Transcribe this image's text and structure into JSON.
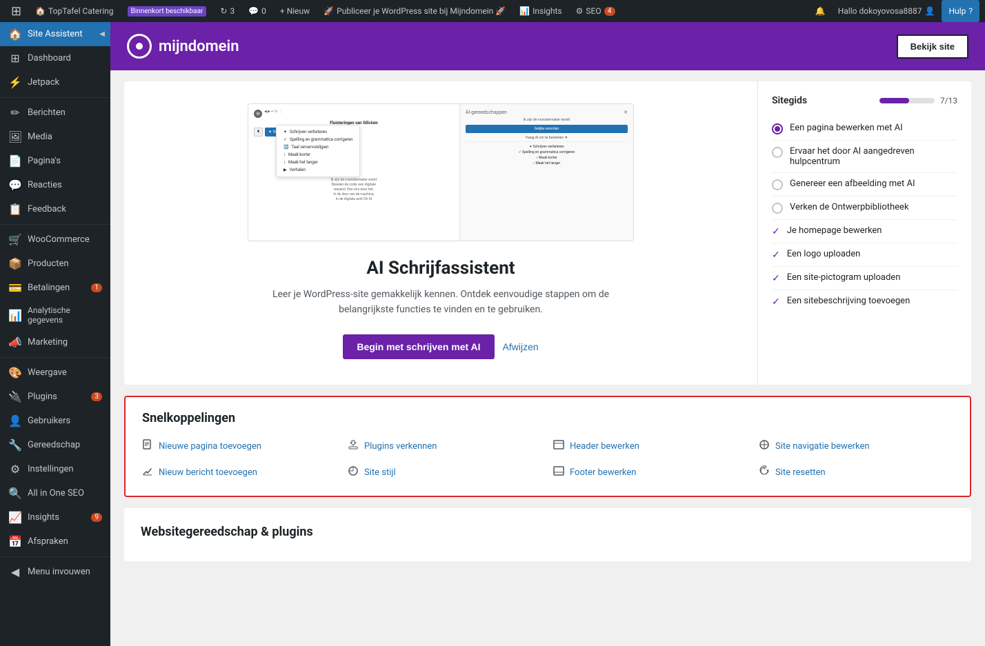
{
  "adminbar": {
    "site_name": "TopTafel Catering",
    "soon_label": "Binnenkort beschikbaar",
    "updates_count": "3",
    "comments_count": "0",
    "new_label": "+ Nieuw",
    "publish_label": "Publiceer je WordPress site bij Mijndomein 🚀",
    "insights_label": "Insights",
    "seo_label": "SEO",
    "seo_badge": "4",
    "hello_label": "Hallo dokoyovosa8887",
    "help_label": "Hulp"
  },
  "sidebar": {
    "items": [
      {
        "label": "Site Assistent",
        "icon": "🏠",
        "active": true
      },
      {
        "label": "Dashboard",
        "icon": "⊞"
      },
      {
        "label": "Jetpack",
        "icon": "⚡"
      },
      {
        "label": "Berichten",
        "icon": "✏️"
      },
      {
        "label": "Media",
        "icon": "🖼"
      },
      {
        "label": "Pagina's",
        "icon": "📄"
      },
      {
        "label": "Reacties",
        "icon": "💬"
      },
      {
        "label": "Feedback",
        "icon": "📋"
      },
      {
        "label": "WooCommerce",
        "icon": "🛒"
      },
      {
        "label": "Producten",
        "icon": "📦"
      },
      {
        "label": "Betalingen",
        "icon": "💳",
        "badge": "1"
      },
      {
        "label": "Analytische gegevens",
        "icon": "📊"
      },
      {
        "label": "Marketing",
        "icon": "📣"
      },
      {
        "label": "Weergave",
        "icon": "🎨"
      },
      {
        "label": "Plugins",
        "icon": "🔌",
        "badge": "3"
      },
      {
        "label": "Gebruikers",
        "icon": "👤"
      },
      {
        "label": "Gereedschap",
        "icon": "🔧"
      },
      {
        "label": "Instellingen",
        "icon": "⚙️"
      },
      {
        "label": "All in One SEO",
        "icon": "🔍"
      },
      {
        "label": "Insights",
        "icon": "📈",
        "badge": "9"
      },
      {
        "label": "Afspraken",
        "icon": "📅"
      },
      {
        "label": "Menu invouwen",
        "icon": "◀"
      }
    ]
  },
  "header": {
    "logo_text": "mijndomein",
    "bekijk_site": "Bekijk site"
  },
  "sitegids": {
    "title": "Sitegids",
    "progress": "7/13",
    "progress_percent": 54,
    "items": [
      {
        "label": "Een pagina bewerken met AI",
        "status": "active"
      },
      {
        "label": "Ervaar het door AI aangedreven hulpcentrum",
        "status": "empty"
      },
      {
        "label": "Genereer een afbeelding met AI",
        "status": "empty"
      },
      {
        "label": "Verken de Ontwerpbibliotheek",
        "status": "empty"
      },
      {
        "label": "Je homepage bewerken",
        "status": "check"
      },
      {
        "label": "Een logo uploaden",
        "status": "check"
      },
      {
        "label": "Een site-pictogram uploaden",
        "status": "check"
      },
      {
        "label": "Een sitebeschrijving toevoegen",
        "status": "check"
      }
    ]
  },
  "ai_feature": {
    "title": "AI Schrijfassistent",
    "description": "Leer je WordPress-site gemakkelijk kennen. Ontdek eenvoudige stappen om de belangrijkste functies te vinden en te gebruiken.",
    "primary_btn": "Begin met schrijven met AI",
    "secondary_btn": "Afwijzen",
    "preview_title": "Fluisteringen van Silicium",
    "menu_items": [
      "Schrijven verbeteren",
      "Spelling en grammatica corrigeren",
      "Taal ververvuislijpen",
      "Maak korter",
      "Maak het langer",
      "Verhalen"
    ]
  },
  "snelkoppelingen": {
    "title": "Snelkoppelingen",
    "items": [
      {
        "label": "Nieuwe pagina toevoegen",
        "icon": "📄",
        "col": 1,
        "row": 1
      },
      {
        "label": "Plugins verkennen",
        "icon": "🔌",
        "col": 2,
        "row": 1
      },
      {
        "label": "Header bewerken",
        "icon": "▭",
        "col": 3,
        "row": 1
      },
      {
        "label": "Site navigatie bewerken",
        "icon": "☉",
        "col": 4,
        "row": 1
      },
      {
        "label": "Nieuw bericht toevoegen",
        "icon": "📝",
        "col": 1,
        "row": 2
      },
      {
        "label": "Site stijl",
        "icon": "◑",
        "col": 2,
        "row": 2
      },
      {
        "label": "Footer bewerken",
        "icon": "▬",
        "col": 3,
        "row": 2
      },
      {
        "label": "Site resetten",
        "icon": "↺",
        "col": 4,
        "row": 2
      }
    ]
  },
  "websitegereedschap": {
    "title": "Websitegereedschap & plugins"
  }
}
